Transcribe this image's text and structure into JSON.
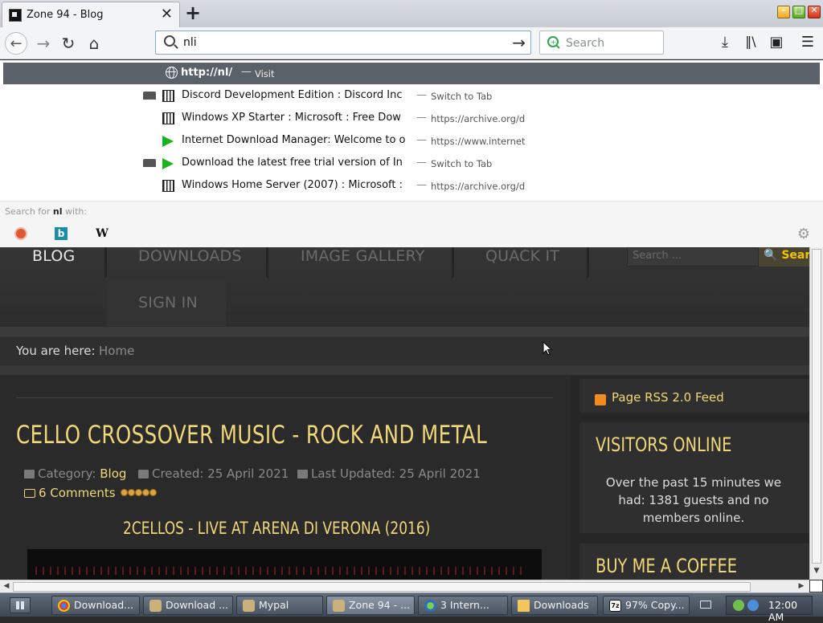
{
  "browser": {
    "tab_title": "Zone 94 - Blog",
    "new_tab": "+",
    "url_value": "nli",
    "search_placeholder": "Search"
  },
  "dropdown": {
    "selected_url": "http://nl/",
    "selected_action": "Visit",
    "rows": [
      {
        "title": "Discord Development Edition : Discord Inc",
        "sub": "Switch to Tab",
        "icon": "archive-icon",
        "switch_tab": true
      },
      {
        "title": "Windows XP Starter : Microsoft : Free Dow",
        "sub": "https://archive.org/d",
        "icon": "archive-icon",
        "switch_tab": false
      },
      {
        "title": "Internet Download Manager: Welcome to o",
        "sub": "https://www.internet",
        "icon": "idm-arrow-icon",
        "switch_tab": false
      },
      {
        "title": "Download the latest free trial version of In",
        "sub": "Switch to Tab",
        "icon": "idm-arrow-icon",
        "switch_tab": true
      },
      {
        "title": "Windows Home Server (2007) : Microsoft :",
        "sub": "https://archive.org/d",
        "icon": "archive-icon",
        "switch_tab": false
      }
    ],
    "search_for_prefix": "Search for",
    "search_for_term": "nl",
    "search_for_suffix": "with:",
    "engines": [
      "duckduckgo-icon",
      "bing-icon",
      "wikipedia-icon"
    ],
    "bing_letter": "b",
    "wiki_letter": "W"
  },
  "site": {
    "menu": {
      "blog": "BLOG",
      "downloads": "DOWNLOADS",
      "gallery": "IMAGE GALLERY",
      "quack": "QUACK IT",
      "signin": "SIGN IN",
      "search_placeholder": "Search ...",
      "search_button": "Search"
    },
    "breadcrumb": {
      "label": "You are here:",
      "home": "Home"
    },
    "article": {
      "title": "CELLO CROSSOVER MUSIC - ROCK AND METAL",
      "category_label": "Category:",
      "category": "Blog",
      "created": "Created: 25 April 2021",
      "updated": "Last Updated: 25 April 2021",
      "comments": "6 Comments",
      "rating_stars": 5,
      "subtitle": "2CELLOS - LIVE AT ARENA DI VERONA (2016)"
    },
    "sidebar": {
      "rss": "Page RSS 2.0 Feed",
      "visitors_title": "VISITORS ONLINE",
      "visitors_text": "Over the past 15 minutes we had: 1381 guests and no members online.",
      "coffee_title": "BUY ME A COFFEE"
    }
  },
  "taskbar": {
    "buttons": [
      {
        "label": "Download...",
        "icon": "chrome-icon"
      },
      {
        "label": "Download ...",
        "icon": "mypal-icon"
      },
      {
        "label": "Mypal",
        "icon": "mypal-icon"
      },
      {
        "label": "Zone 94 - ...",
        "icon": "mypal-icon"
      },
      {
        "label": "3 Intern...",
        "icon": "internet-icon"
      },
      {
        "label": "Downloads",
        "icon": "folder-icon"
      },
      {
        "label": "97% Copy...",
        "icon": "7zip-icon"
      }
    ],
    "clock": "12:00 AM",
    "copy_icon_text": "7z"
  }
}
